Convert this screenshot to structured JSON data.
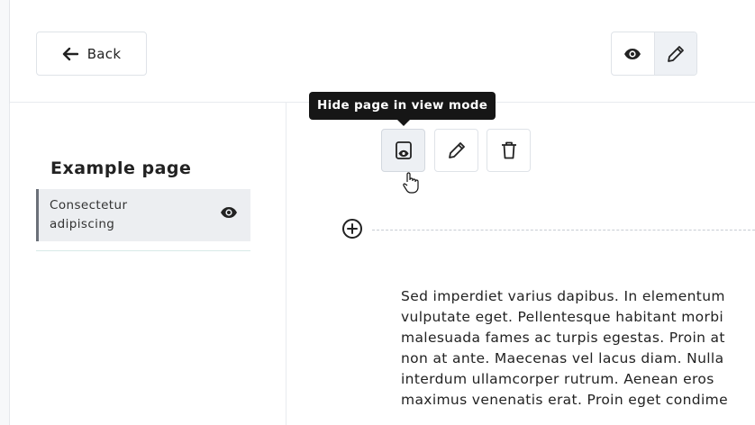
{
  "header": {
    "back_label": "Back",
    "mode_toggle": {
      "view_icon": "eye-icon",
      "edit_icon": "pencil-icon",
      "active": "edit"
    }
  },
  "sidebar": {
    "page_title": "Example page",
    "items": [
      {
        "label": "Consectetur adipiscing",
        "icon": "eye-icon"
      }
    ]
  },
  "toolbar": {
    "tooltip": "Hide page in view mode",
    "buttons": [
      {
        "name": "hide-in-view-button",
        "icon": "eye-off-page-icon"
      },
      {
        "name": "edit-button",
        "icon": "pencil-icon"
      },
      {
        "name": "delete-button",
        "icon": "trash-icon"
      }
    ]
  },
  "content": {
    "lines": [
      "Sed imperdiet varius dapibus. In elementum",
      "vulputate eget. Pellentesque habitant morbi",
      "malesuada fames ac turpis egestas. Proin at",
      "non at ante. Maecenas vel lacus diam. Nulla",
      "interdum ullamcorper rutrum. Aenean eros",
      "maximus venenatis erat. Proin eget condime"
    ]
  },
  "colors": {
    "tooltip_bg": "#161616",
    "accent_border": "#6b7079",
    "active_bg": "#eef1f5"
  }
}
